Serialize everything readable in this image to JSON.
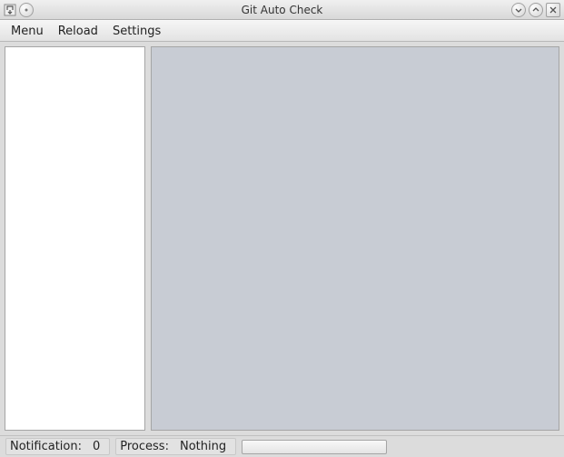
{
  "title": "Git Auto Check",
  "menubar": {
    "menu": "Menu",
    "reload": "Reload",
    "settings": "Settings"
  },
  "statusbar": {
    "notification_label": "Notification:",
    "notification_value": "0",
    "process_label": "Process:",
    "process_value": "Nothing"
  }
}
